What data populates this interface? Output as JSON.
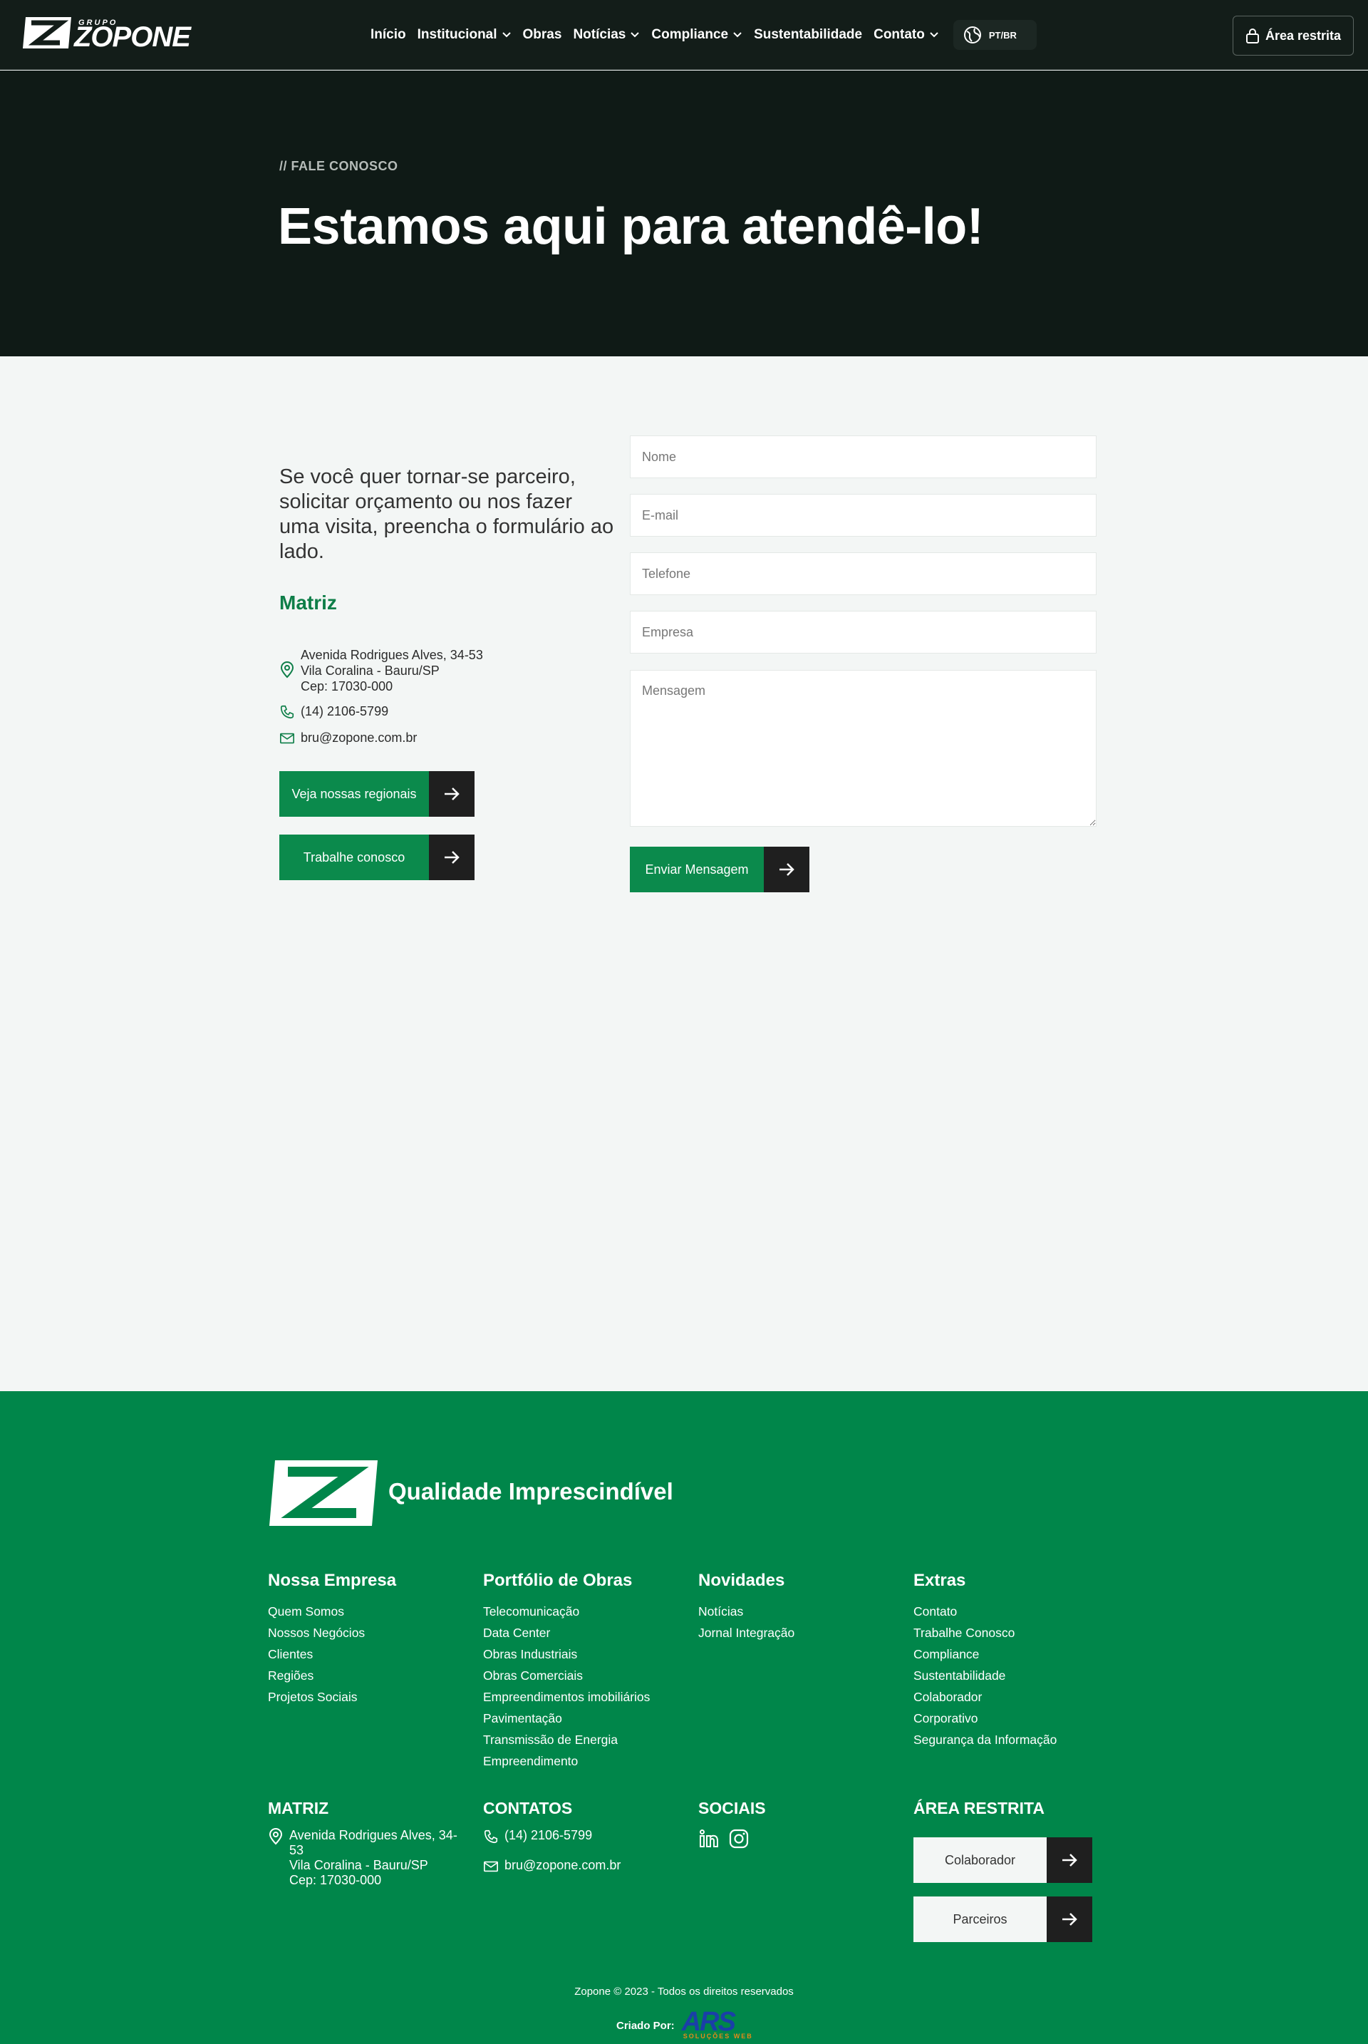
{
  "header": {
    "logo_grupo": "GRUPO",
    "logo_word": "ZOPONE",
    "nav": [
      {
        "label": "Início",
        "dropdown": false
      },
      {
        "label": "Institucional",
        "dropdown": true
      },
      {
        "label": "Obras",
        "dropdown": false
      },
      {
        "label": "Notícias",
        "dropdown": true
      },
      {
        "label": "Compliance",
        "dropdown": true
      },
      {
        "label": "Sustentabilidade",
        "dropdown": false
      },
      {
        "label": "Contato",
        "dropdown": true
      }
    ],
    "language": "PT/BR",
    "restricted_label": "Área restrita"
  },
  "hero": {
    "kicker": "// FALE CONOSCO",
    "title": "Estamos aqui para atendê-lo!"
  },
  "contact": {
    "intro": "Se você quer tornar-se parceiro, solicitar orçamento ou nos fazer uma visita, preencha o formulário ao lado.",
    "matriz_title": "Matriz",
    "address": [
      "Avenida Rodrigues Alves, 34-53",
      "Vila Coralina - Bauru/SP",
      "Cep: 17030-000"
    ],
    "phone": "(14) 2106-5799",
    "email": "bru@zopone.com.br",
    "regionais_button": "Veja nossas regionais",
    "trabalhe_button": "Trabalhe conosco"
  },
  "form": {
    "name_placeholder": "Nome",
    "email_placeholder": "E-mail",
    "phone_placeholder": "Telefone",
    "company_placeholder": "Empresa",
    "message_placeholder": "Mensagem",
    "submit_label": "Enviar Mensagem"
  },
  "footer": {
    "tagline": "Qualidade Imprescindível",
    "columns": [
      {
        "title": "Nossa Empresa",
        "links": [
          "Quem Somos",
          "Nossos Negócios",
          "Clientes",
          "Regiões",
          "Projetos Sociais"
        ]
      },
      {
        "title": "Portfólio de Obras",
        "links": [
          "Telecomunicação",
          "Data Center",
          "Obras Industriais",
          "Obras Comerciais",
          "Empreendimentos imobiliários",
          "Pavimentação",
          "Transmissão de Energia",
          "Empreendimento"
        ]
      },
      {
        "title": "Novidades",
        "links": [
          "Notícias",
          "Jornal Integração"
        ]
      },
      {
        "title": "Extras",
        "links": [
          "Contato",
          "Trabalhe Conosco",
          "Compliance",
          "Sustentabilidade",
          "Colaborador",
          "Corporativo",
          "Segurança da Informação"
        ]
      }
    ],
    "matriz_title": "MATRIZ",
    "matriz_address": [
      "Avenida Rodrigues Alves, 34-",
      "53",
      "Vila Coralina - Bauru/SP",
      "Cep: 17030-000"
    ],
    "contatos_title": "CONTATOS",
    "phone": "(14) 2106-5799",
    "email": "bru@zopone.com.br",
    "sociais_title": "SOCIAIS",
    "area_title": "ÁREA RESTRITA",
    "colaborador_button": "Colaborador",
    "parceiros_button": "Parceiros",
    "copyright": "Zopone © 2023 - Todos os direitos reservados",
    "created_by": "Criado Por:",
    "creator_logo": "ARS",
    "creator_sub": "SOLUÇÕES WEB"
  },
  "colors": {
    "brand_green": "#00864a",
    "button_green": "#0b8a4c",
    "dark_header": "#131d19",
    "hero_bg": "#0f1a16",
    "content_bg": "#f3f6f5"
  }
}
